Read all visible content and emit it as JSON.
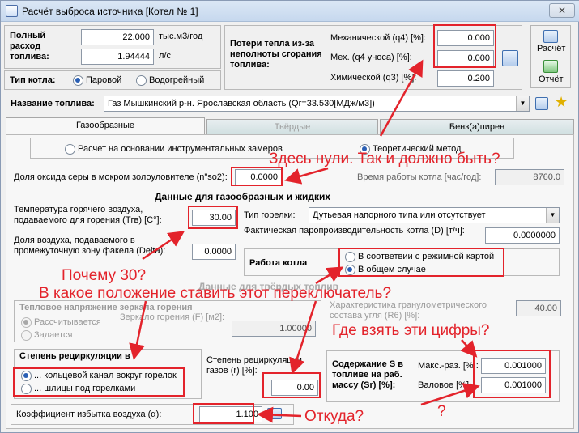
{
  "window": {
    "title": "Расчёт выброса источника [Котел № 1]",
    "close_glyph": "✕"
  },
  "fuel_consumption": {
    "label": "Полный расход топлива:",
    "value1": "22.000",
    "unit1": "тыс.м3/год",
    "value2": "1.94444",
    "unit2": "л/с"
  },
  "boiler_type": {
    "label": "Тип котла:",
    "options": [
      "Паровой",
      "Водогрейный"
    ],
    "selected": "Паровой"
  },
  "heat_losses": {
    "label": "Потери тепла из-за неполноты сгорания топлива:",
    "mech_label": "Механической (q4) [%]:",
    "mech_value": "0.000",
    "mech_ash_label": "Мех. (q4 уноса) [%]:",
    "mech_ash_value": "0.000",
    "chem_label": "Химической (q3) [%]:",
    "chem_value": "0.200"
  },
  "side_buttons": {
    "calc": "Расчёт",
    "report": "Отчёт"
  },
  "fuel_name": {
    "label": "Название топлива:",
    "value": "Газ Мышкинский р-н. Ярославская область (Qr=33.530[МДж/м3])"
  },
  "tabs": [
    "Газообразные",
    "Твёрдые",
    "Бенз(а)пирен"
  ],
  "method": {
    "options": [
      "Расчет на основании инструментальных замеров",
      "Теоретический метод"
    ],
    "selected": "Теоретический метод"
  },
  "sulfur_oxide": {
    "label": "Доля оксида серы в мокром золоуловителе (n\"so2):",
    "value": "0.0000"
  },
  "boiler_hours": {
    "label": "Время работы котла [час/год]:",
    "value": "8760.0"
  },
  "gas_liquid": {
    "title": "Данные для газообразных и жидких",
    "hot_air_label": "Температура горячего воздуха, подаваемого для горения (Tгв) [C°]:",
    "hot_air_value": "30.00",
    "burner_type_label": "Тип горелки:",
    "burner_type_value": "Дутьевая напорного типа или отсутствует",
    "steam_label": "Фактическая паропроизводительность котла (D) [т/ч]:",
    "steam_value": "0.0000000",
    "air_share_label": "Доля воздуха, подаваемого в промежуточную зону факела (Delta):",
    "air_share_value": "0.0000",
    "boiler_mode_label": "Работа котла",
    "boiler_mode_options": [
      "В соответвии с режимной картой",
      "В общем случае"
    ],
    "boiler_mode_selected": "В общем случае"
  },
  "solid": {
    "title": "Данные для твёрдых топлив",
    "heat_stress_label": "Тепловое напряжение зеркала горения",
    "heat_stress_options": [
      "Рассчитывается",
      "Задается"
    ],
    "heat_stress_selected": "Рассчитывается",
    "mirror_label": "Зеркало горения (F) [м2]:",
    "mirror_value": "1.00000",
    "granul_label": "Характеристика гранулометрического состава угля (R6) [%]:",
    "granul_value": "40.00"
  },
  "recirculation": {
    "label": "Степень рециркуляции в",
    "options": [
      "... кольцевой канал вокруг горелок",
      "... шлицы под горелками"
    ],
    "selected": "... кольцевой канал вокруг горелок",
    "gas_label": "Степень рециркуляции газов (r) [%]:",
    "gas_value": "0.00"
  },
  "sulfur": {
    "label": "Содержание S в топливе на раб. массу (Sr) [%]:",
    "max_label": "Макс.-раз. [%]:",
    "max_value": "0.001000",
    "gross_label": "Валовое [%]:",
    "gross_value": "0.001000"
  },
  "excess_air": {
    "label": "Коэффициент избытка воздуха (α):",
    "value": "1.100"
  },
  "annotations": {
    "zeros": "Здесь нули. Так и должно быть?",
    "why30": "Почему 30?",
    "switch": "В какое положение ставить этот переключатель?",
    "numbers": "Где взять эти цифры?",
    "question": "?",
    "from_where": "Откуда?"
  },
  "colors": {
    "annotation": "#e3232b",
    "accent": "#2a5fb4"
  }
}
